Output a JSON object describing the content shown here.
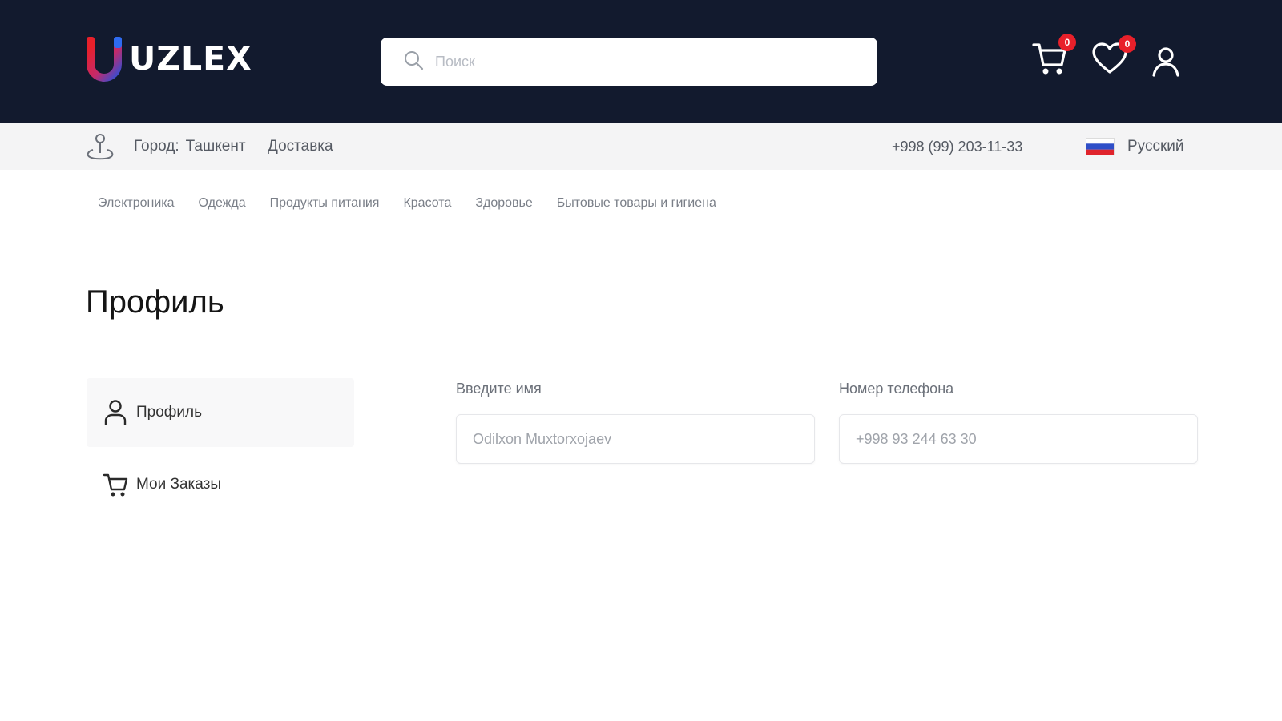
{
  "brand": {
    "name": "UZLEX"
  },
  "search": {
    "placeholder": "Поиск"
  },
  "header_icons": {
    "cart_count": "0",
    "wishlist_count": "0"
  },
  "subbar": {
    "city_label": "Город:",
    "city_value": "Ташкент",
    "delivery": "Доставка",
    "phone": "+998 (99) 203-11-33",
    "language": "Русский"
  },
  "categories": [
    "Электроника",
    "Одежда",
    "Продукты питания",
    "Красота",
    "Здоровье",
    "Бытовые товары и гигиена"
  ],
  "page": {
    "title": "Профиль"
  },
  "sidebar": {
    "items": [
      {
        "label": "Профиль",
        "icon": "user-icon",
        "active": true
      },
      {
        "label": "Мои Заказы",
        "icon": "cart-icon",
        "active": false
      }
    ]
  },
  "form": {
    "name_label": "Введите имя",
    "name_value": "Odilxon Muxtorxojaev",
    "phone_label": "Номер телефона",
    "phone_value": "+998 93 244 63 30"
  },
  "colors": {
    "header_bg": "#121a2e",
    "badge": "#e8202a",
    "subbar_bg": "#f4f4f5"
  }
}
